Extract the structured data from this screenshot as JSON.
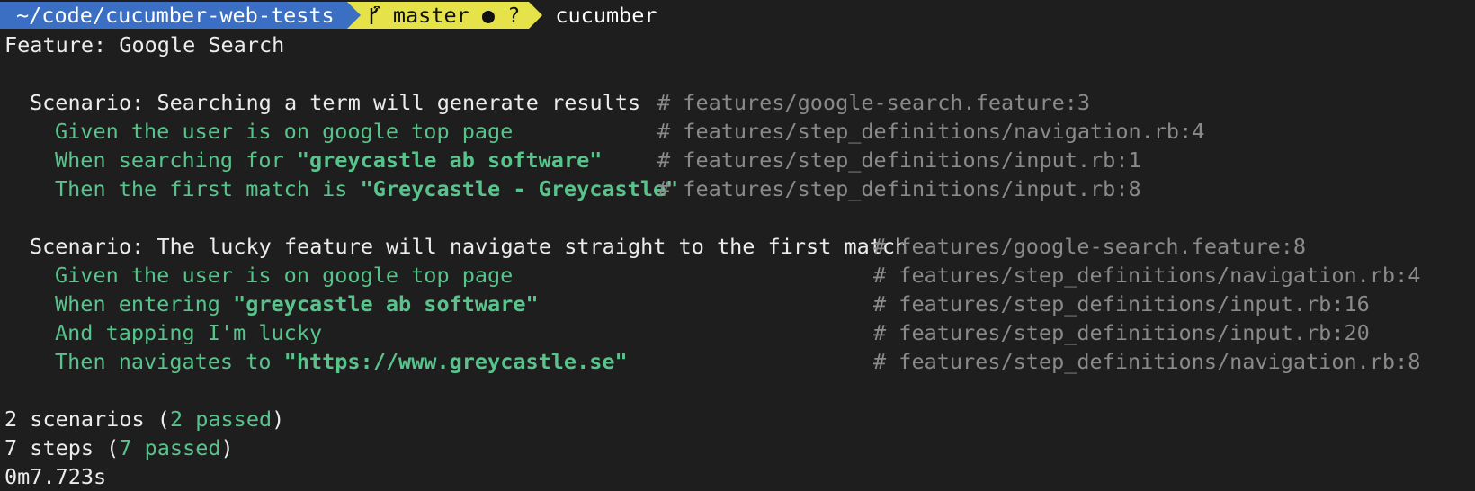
{
  "prompt": {
    "path": "~/code/cucumber-web-tests",
    "branch_icon": "git-branch-icon",
    "branch": "master",
    "status": "● ?",
    "command": "cucumber"
  },
  "feature": "Feature: Google Search",
  "scenarios": [
    {
      "title": "Scenario: Searching a term will generate results",
      "location": "# features/google-search.feature:3",
      "steps": [
        {
          "pre": "Given the user is on google top page",
          "arg": "",
          "post": "",
          "location": "# features/step_definitions/navigation.rb:4"
        },
        {
          "pre": "When searching for ",
          "arg": "\"greycastle ab software\"",
          "post": "",
          "location": "# features/step_definitions/input.rb:1"
        },
        {
          "pre": "Then the first match is ",
          "arg": "\"Greycastle - Greycastle\"",
          "post": "",
          "location": "# features/step_definitions/input.rb:8"
        }
      ]
    },
    {
      "title": "Scenario: The lucky feature will navigate straight to the first match",
      "location": "# features/google-search.feature:8",
      "steps": [
        {
          "pre": "Given the user is on google top page",
          "arg": "",
          "post": "",
          "location": "# features/step_definitions/navigation.rb:4"
        },
        {
          "pre": "When entering ",
          "arg": "\"greycastle ab software\"",
          "post": "",
          "location": "# features/step_definitions/input.rb:16"
        },
        {
          "pre": "And tapping I'm lucky",
          "arg": "",
          "post": "",
          "location": "# features/step_definitions/input.rb:20"
        },
        {
          "pre": "Then navigates to ",
          "arg": "\"https://www.greycastle.se\"",
          "post": "",
          "location": "# features/step_definitions/navigation.rb:8"
        }
      ]
    }
  ],
  "summary": {
    "scenarios": {
      "prefix": "2 scenarios (",
      "passed": "2 passed",
      "suffix": ")"
    },
    "steps": {
      "prefix": "7 steps (",
      "passed": "7 passed",
      "suffix": ")"
    },
    "time": "0m7.723s"
  },
  "colors": {
    "background": "#1e1e1e",
    "path_segment": "#3a6fc4",
    "git_segment": "#e6e34a",
    "passed_green": "#58c48c",
    "comment_gray": "#8a8a8a"
  }
}
